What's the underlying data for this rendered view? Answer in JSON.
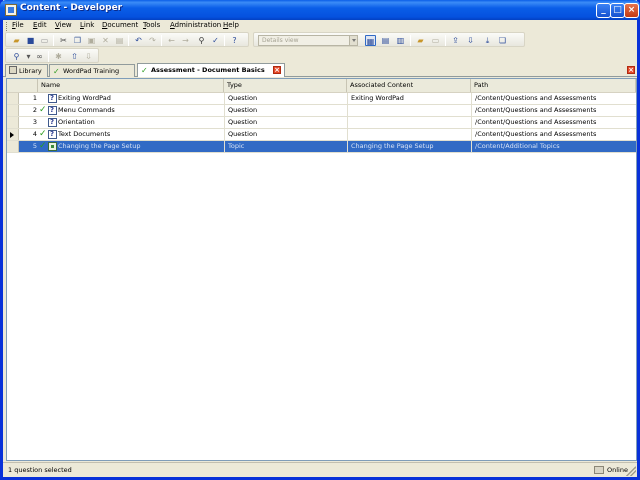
{
  "window": {
    "title": "Content - Developer",
    "minimize_glyph": "_",
    "maximize_glyph": "□",
    "close_glyph": "×"
  },
  "menubar": {
    "items": [
      "File",
      "Edit",
      "View",
      "Link",
      "Document",
      "Tools",
      "Administration",
      "Help"
    ],
    "hotkeys": [
      "F",
      "E",
      "V",
      "L",
      "D",
      "T",
      "A",
      "H"
    ]
  },
  "toolbar": {
    "view_select": "Details view"
  },
  "tabs": [
    {
      "label": "Library",
      "icon": "library-icon",
      "active": false
    },
    {
      "label": "WordPad Training",
      "icon": "outline-checked-icon",
      "active": false
    },
    {
      "label": "Assessment - Document Basics",
      "icon": "assessment-checked-icon",
      "active": true
    }
  ],
  "grid": {
    "columns": [
      "Name",
      "Type",
      "Associated Content",
      "Path"
    ],
    "rows": [
      {
        "num": "1",
        "checked": false,
        "icon": "question-doc-icon",
        "name": "Exiting WordPad",
        "type": "Question",
        "assoc": "Exiting WordPad",
        "path": "/Content/Questions and Assessments",
        "current": false,
        "selected": false
      },
      {
        "num": "2",
        "checked": true,
        "icon": "question-doc-icon",
        "name": "Menu Commands",
        "type": "Question",
        "assoc": "",
        "path": "/Content/Questions and Assessments",
        "current": false,
        "selected": false
      },
      {
        "num": "3",
        "checked": false,
        "icon": "question-doc-icon",
        "name": "Orientation",
        "type": "Question",
        "assoc": "",
        "path": "/Content/Questions and Assessments",
        "current": false,
        "selected": false
      },
      {
        "num": "4",
        "checked": true,
        "icon": "question-doc-icon",
        "name": "Text Documents",
        "type": "Question",
        "assoc": "",
        "path": "/Content/Questions and Assessments",
        "current": true,
        "selected": false
      },
      {
        "num": "5",
        "checked": true,
        "icon": "topic-doc-icon",
        "name": "Changing the Page Setup",
        "type": "Topic",
        "assoc": "Changing the Page Setup",
        "path": "/Content/Additional Topics",
        "current": false,
        "selected": true
      }
    ]
  },
  "statusbar": {
    "left_text": "1 question selected",
    "right_text": "Online"
  },
  "colors": {
    "title_blue": "#0a5ee8",
    "selection": "#316ac5",
    "check_green": "#2d9c1f"
  }
}
